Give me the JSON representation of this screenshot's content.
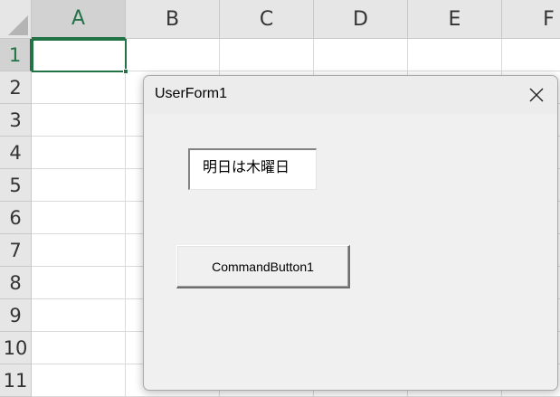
{
  "sheet": {
    "columns": [
      "A",
      "B",
      "C",
      "D",
      "E",
      "F"
    ],
    "rows": [
      "1",
      "2",
      "3",
      "4",
      "5",
      "6",
      "7",
      "8",
      "9",
      "10",
      "11"
    ],
    "active_cell": "A1",
    "accent_color": "#217346"
  },
  "userform": {
    "title": "UserForm1",
    "close_icon": "close-icon",
    "textbox_value": "明日は木曜日",
    "command_button_label": "CommandButton1"
  }
}
